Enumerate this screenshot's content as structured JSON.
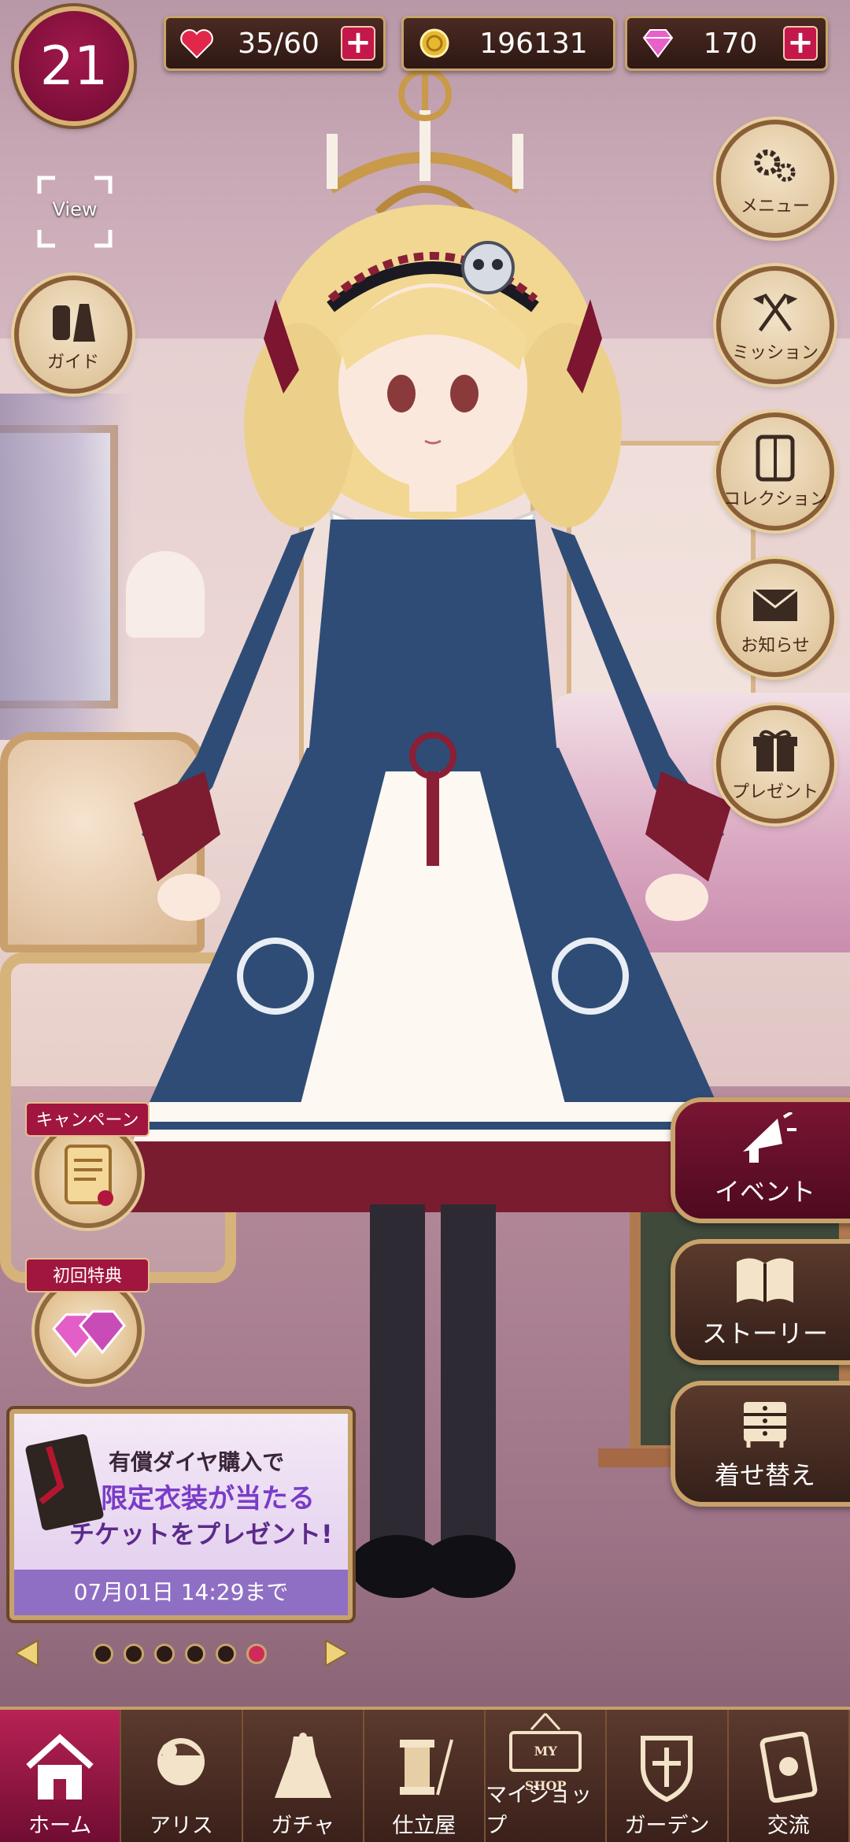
{
  "status_bar": {
    "level": "21",
    "stamina": "35/60",
    "coins": "196131",
    "gems": "170"
  },
  "left_buttons": {
    "view": "View",
    "guide": "ガイド"
  },
  "right_buttons": {
    "menu": "メニュー",
    "mission": "ミッション",
    "collection": "コレクション",
    "news": "お知らせ",
    "present": "プレゼント"
  },
  "promos": {
    "campaign": "キャンペーン",
    "first_bonus": "初回特典"
  },
  "banner": {
    "line1": "有償ダイヤ購入で",
    "line2": "限定衣装が当たる",
    "line3": "チケットをプレゼント!",
    "deadline": "07月01日 14:29まで",
    "page_count": 6,
    "active_page": 6
  },
  "side_tabs": {
    "event": "イベント",
    "story": "ストーリー",
    "dressup": "着せ替え"
  },
  "bottom_nav": {
    "home": "ホーム",
    "alice": "アリス",
    "gacha": "ガチャ",
    "tailor": "仕立屋",
    "myshop": "マイショップ",
    "myshop_sign": "MY SHOP",
    "garden": "ガーデン",
    "exchange": "交流"
  },
  "colors": {
    "accent": "#a2184d",
    "frame_gold": "#c8a26a",
    "panel_dark": "#3a201a"
  }
}
